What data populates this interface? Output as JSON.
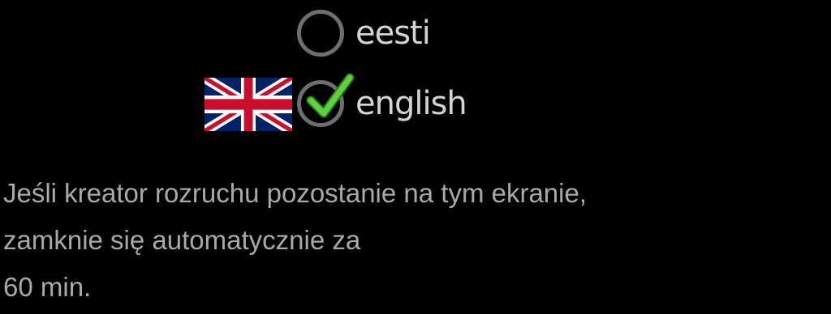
{
  "language_options": [
    {
      "label": "eesti",
      "selected": false
    },
    {
      "label": "english",
      "selected": true,
      "flag_icon": "uk-flag-icon"
    }
  ],
  "colors": {
    "background": "#000000",
    "radio_ring": "#6e6e6e",
    "check": "#5fd13f",
    "label_text": "#d4d4d4",
    "info_text": "#a9a9a9"
  },
  "info": {
    "line1": "Jeśli kreator rozruchu pozostanie na tym ekranie,",
    "line2": "zamknie się automatycznie za",
    "line3": "60 min."
  }
}
